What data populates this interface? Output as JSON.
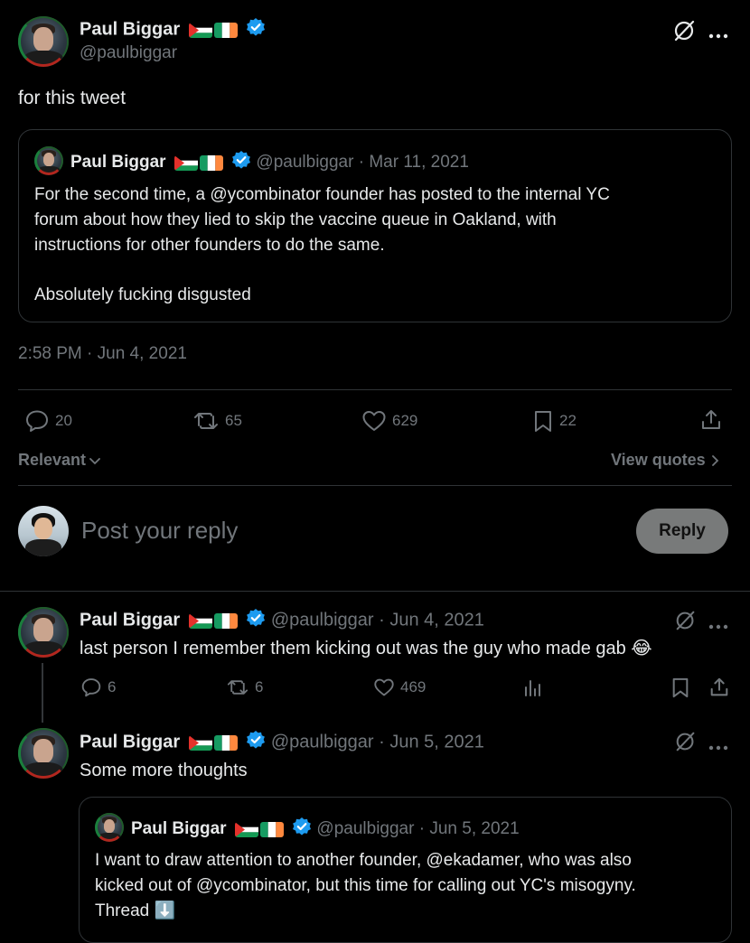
{
  "main_tweet": {
    "author_name": "Paul Biggar",
    "handle": "@paulbiggar",
    "text": "for this tweet",
    "timestamp": "2:58 PM · Jun 4, 2021",
    "quoted": {
      "author_name": "Paul Biggar",
      "handle": "@paulbiggar",
      "date": "· Mar 11, 2021",
      "lines": [
        "For the second time, a @ycombinator founder has posted to the internal YC",
        "forum about how they lied to skip the vaccine queue in Oakland, with",
        "instructions for other founders to do the same.",
        "Absolutely fucking disgusted"
      ]
    },
    "stats": {
      "replies": "20",
      "reposts": "65",
      "likes": "629",
      "bookmarks": "22"
    }
  },
  "sort": {
    "label": "Relevant",
    "view_quotes": "View quotes"
  },
  "composer": {
    "placeholder": "Post your reply",
    "button": "Reply"
  },
  "replies": [
    {
      "author_name": "Paul Biggar",
      "handle": "@paulbiggar",
      "date": "· Jun 4, 2021",
      "text": "last person I remember them kicking out was the guy who made gab 😂",
      "stats": {
        "replies": "6",
        "reposts": "6",
        "likes": "469"
      }
    },
    {
      "author_name": "Paul Biggar",
      "handle": "@paulbiggar",
      "date": "· Jun 5, 2021",
      "text": "Some more thoughts",
      "quoted": {
        "author_name": "Paul Biggar",
        "handle": "@paulbiggar",
        "date": "· Jun 5, 2021",
        "lines": [
          "I want to draw attention to another founder, @ekadamer, who was also",
          "kicked out of @ycombinator, but this time for calling out YC's misogyny.",
          "Thread ⬇️"
        ]
      }
    }
  ],
  "colors": {
    "background": "#000000",
    "text": "#e7e9ea",
    "muted": "#71767b",
    "verified": "#1d9bf0",
    "divider": "#2f3336"
  }
}
